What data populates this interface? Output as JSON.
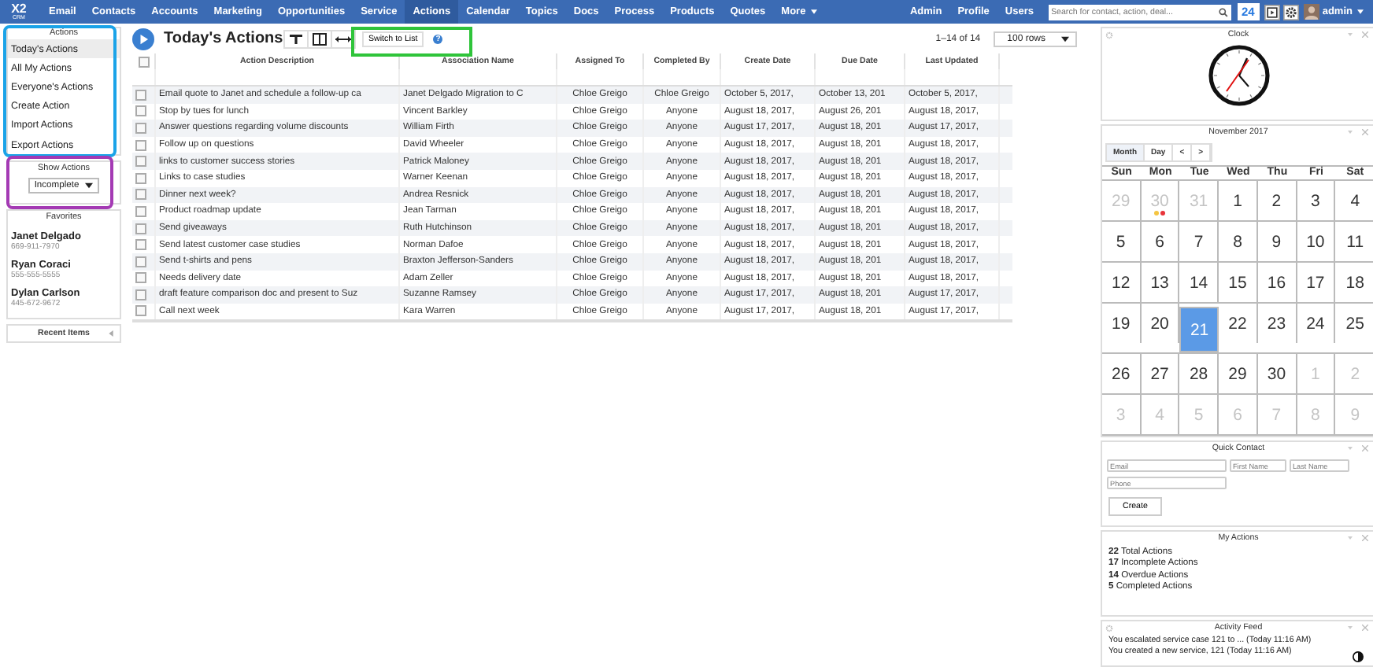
{
  "nav": {
    "logo_top": "X2",
    "logo_bottom": "CRM",
    "items": [
      {
        "label": "Email",
        "selected": false
      },
      {
        "label": "Contacts",
        "selected": false
      },
      {
        "label": "Accounts",
        "selected": false
      },
      {
        "label": "Marketing",
        "selected": false
      },
      {
        "label": "Opportunities",
        "selected": false
      },
      {
        "label": "Service",
        "selected": false
      },
      {
        "label": "Actions",
        "selected": true
      },
      {
        "label": "Calendar",
        "selected": false
      },
      {
        "label": "Topics",
        "selected": false
      },
      {
        "label": "Docs",
        "selected": false
      },
      {
        "label": "Process",
        "selected": false
      },
      {
        "label": "Products",
        "selected": false
      },
      {
        "label": "Quotes",
        "selected": false
      }
    ],
    "more": "More",
    "right_items": [
      "Admin",
      "Profile",
      "Users"
    ],
    "search": {
      "placeholder": "Search for contact, action, deal..."
    },
    "badge": "24",
    "user": "admin"
  },
  "sidebar": {
    "actions": {
      "title": "Actions",
      "items": [
        {
          "label": "Today's Actions",
          "selected": true
        },
        {
          "label": "All My Actions",
          "selected": false
        },
        {
          "label": "Everyone's Actions",
          "selected": false
        },
        {
          "label": "Create Action",
          "selected": false
        },
        {
          "label": "Import Actions",
          "selected": false
        },
        {
          "label": "Export Actions",
          "selected": false
        }
      ]
    },
    "show_actions": {
      "title": "Show Actions",
      "value": "Incomplete"
    },
    "favorites": {
      "title": "Favorites",
      "contacts": [
        {
          "name": "Janet Delgado",
          "phone": "669-911-7970"
        },
        {
          "name": "Ryan Coraci",
          "phone": "555-555-5555"
        },
        {
          "name": "Dylan Carlson",
          "phone": "445-672-9672"
        }
      ]
    },
    "recent": {
      "title": "Recent Items"
    }
  },
  "main": {
    "title": "Today's Actions",
    "switch_button": "Switch to List",
    "help": "?",
    "pagination": "1–14 of 14",
    "rows_select": "100 rows",
    "table": {
      "select_all_checked": false,
      "columns": [
        "Action Description",
        "Association Name",
        "Assigned To",
        "Completed By",
        "Create Date",
        "Due Date",
        "Last Updated"
      ],
      "rows": [
        {
          "checked": false,
          "cells": [
            "Email quote to Janet and schedule a follow-up ca",
            "Janet Delgado Migration to C",
            "Chloe Greigo",
            "Chloe Greigo",
            "October 5, 2017,",
            "October 13, 201",
            "October 5, 2017,"
          ]
        },
        {
          "checked": false,
          "cells": [
            "Stop by tues for lunch",
            "Vincent Barkley",
            "Chloe Greigo",
            "Anyone",
            "August 18, 2017,",
            "August 26, 201",
            "August 18, 2017,"
          ]
        },
        {
          "checked": false,
          "cells": [
            "Answer questions regarding volume discounts",
            "William Firth",
            "Chloe Greigo",
            "Anyone",
            "August 17, 2017,",
            "August 18, 201",
            "August 17, 2017,"
          ]
        },
        {
          "checked": false,
          "cells": [
            "Follow up on questions",
            "David Wheeler",
            "Chloe Greigo",
            "Anyone",
            "August 18, 2017,",
            "August 18, 201",
            "August 18, 2017,"
          ]
        },
        {
          "checked": false,
          "cells": [
            "links to customer success stories",
            "Patrick Maloney",
            "Chloe Greigo",
            "Anyone",
            "August 18, 2017,",
            "August 18, 201",
            "August 18, 2017,"
          ]
        },
        {
          "checked": false,
          "cells": [
            "Links to case studies",
            "Warner Keenan",
            "Chloe Greigo",
            "Anyone",
            "August 18, 2017,",
            "August 18, 201",
            "August 18, 2017,"
          ]
        },
        {
          "checked": false,
          "cells": [
            "Dinner next week?",
            "Andrea Resnick",
            "Chloe Greigo",
            "Anyone",
            "August 18, 2017,",
            "August 18, 201",
            "August 18, 2017,"
          ]
        },
        {
          "checked": false,
          "cells": [
            "Product roadmap update",
            "Jean Tarman",
            "Chloe Greigo",
            "Anyone",
            "August 18, 2017,",
            "August 18, 201",
            "August 18, 2017,"
          ]
        },
        {
          "checked": false,
          "cells": [
            "Send giveaways",
            "Ruth Hutchinson",
            "Chloe Greigo",
            "Anyone",
            "August 18, 2017,",
            "August 18, 201",
            "August 18, 2017,"
          ]
        },
        {
          "checked": false,
          "cells": [
            "Send latest customer case studies",
            "Norman Dafoe",
            "Chloe Greigo",
            "Anyone",
            "August 18, 2017,",
            "August 18, 201",
            "August 18, 2017,"
          ]
        },
        {
          "checked": false,
          "cells": [
            "Send t-shirts and pens",
            "Braxton Jefferson-Sanders",
            "Chloe Greigo",
            "Anyone",
            "August 18, 2017,",
            "August 18, 201",
            "August 18, 2017,"
          ]
        },
        {
          "checked": false,
          "cells": [
            "Needs delivery date",
            "Adam Zeller",
            "Chloe Greigo",
            "Anyone",
            "August 18, 2017,",
            "August 18, 201",
            "August 18, 2017,"
          ]
        },
        {
          "checked": false,
          "cells": [
            "draft feature comparison doc and present to Suz",
            "Suzanne Ramsey",
            "Chloe Greigo",
            "Anyone",
            "August 17, 2017,",
            "August 18, 201",
            "August 17, 2017,"
          ]
        },
        {
          "checked": false,
          "cells": [
            "Call next week",
            "Kara Warren",
            "Chloe Greigo",
            "Anyone",
            "August 17, 2017,",
            "August 18, 201",
            "August 17, 2017,"
          ]
        }
      ]
    }
  },
  "widgets": {
    "clock": {
      "title": "Clock"
    },
    "calendar": {
      "title": "November 2017",
      "views": [
        {
          "label": "Month",
          "selected": true
        },
        {
          "label": "Day",
          "selected": false
        }
      ],
      "prev": "<",
      "next": ">",
      "weekdays": [
        "Sun",
        "Mon",
        "Tue",
        "Wed",
        "Thu",
        "Fri",
        "Sat"
      ],
      "weeks": [
        [
          {
            "day": "29",
            "muted": true,
            "selected": false
          },
          {
            "day": "30",
            "muted": true,
            "selected": false,
            "events": [
              {
                "color": "#f5c542"
              },
              {
                "color": "#e8343a"
              }
            ]
          },
          {
            "day": "31",
            "muted": true,
            "selected": false
          },
          {
            "day": "1",
            "muted": false,
            "selected": false
          },
          {
            "day": "2",
            "muted": false,
            "selected": false
          },
          {
            "day": "3",
            "muted": false,
            "selected": false
          },
          {
            "day": "4",
            "muted": false,
            "selected": false
          }
        ],
        [
          {
            "day": "5",
            "muted": false,
            "selected": false
          },
          {
            "day": "6",
            "muted": false,
            "selected": false
          },
          {
            "day": "7",
            "muted": false,
            "selected": false
          },
          {
            "day": "8",
            "muted": false,
            "selected": false
          },
          {
            "day": "9",
            "muted": false,
            "selected": false
          },
          {
            "day": "10",
            "muted": false,
            "selected": false
          },
          {
            "day": "11",
            "muted": false,
            "selected": false
          }
        ],
        [
          {
            "day": "12",
            "muted": false,
            "selected": false
          },
          {
            "day": "13",
            "muted": false,
            "selected": false
          },
          {
            "day": "14",
            "muted": false,
            "selected": false
          },
          {
            "day": "15",
            "muted": false,
            "selected": false
          },
          {
            "day": "16",
            "muted": false,
            "selected": false
          },
          {
            "day": "17",
            "muted": false,
            "selected": false
          },
          {
            "day": "18",
            "muted": false,
            "selected": false
          }
        ],
        [
          {
            "day": "19",
            "muted": false,
            "selected": false
          },
          {
            "day": "20",
            "muted": false,
            "selected": false
          },
          {
            "day": "21",
            "muted": false,
            "selected": true
          },
          {
            "day": "22",
            "muted": false,
            "selected": false
          },
          {
            "day": "23",
            "muted": false,
            "selected": false
          },
          {
            "day": "24",
            "muted": false,
            "selected": false
          },
          {
            "day": "25",
            "muted": false,
            "selected": false
          }
        ],
        [
          {
            "day": "26",
            "muted": false,
            "selected": false
          },
          {
            "day": "27",
            "muted": false,
            "selected": false
          },
          {
            "day": "28",
            "muted": false,
            "selected": false
          },
          {
            "day": "29",
            "muted": false,
            "selected": false
          },
          {
            "day": "30",
            "muted": false,
            "selected": false
          },
          {
            "day": "1",
            "muted": true,
            "selected": false
          },
          {
            "day": "2",
            "muted": true,
            "selected": false
          }
        ],
        [
          {
            "day": "3",
            "muted": true,
            "selected": false
          },
          {
            "day": "4",
            "muted": true,
            "selected": false
          },
          {
            "day": "5",
            "muted": true,
            "selected": false
          },
          {
            "day": "6",
            "muted": true,
            "selected": false
          },
          {
            "day": "7",
            "muted": true,
            "selected": false
          },
          {
            "day": "8",
            "muted": true,
            "selected": false
          },
          {
            "day": "9",
            "muted": true,
            "selected": false
          }
        ]
      ]
    },
    "quick_contact": {
      "title": "Quick Contact",
      "fields": [
        {
          "placeholder": "Email"
        },
        {
          "placeholder": "First Name"
        },
        {
          "placeholder": "Last Name"
        },
        {
          "placeholder": "Phone"
        }
      ],
      "button": "Create"
    },
    "my_actions": {
      "title": "My Actions",
      "items": [
        "**22** Total Actions",
        "**17** Incomplete Actions",
        "**14** Overdue Actions",
        "**5** Completed Actions"
      ]
    },
    "activity_feed": {
      "title": "Activity Feed",
      "items": [
        "You escalated service case 121 to ... (Today 11:16 AM)",
        "You created a new service, 121 (Today 11:16 AM)"
      ]
    }
  }
}
